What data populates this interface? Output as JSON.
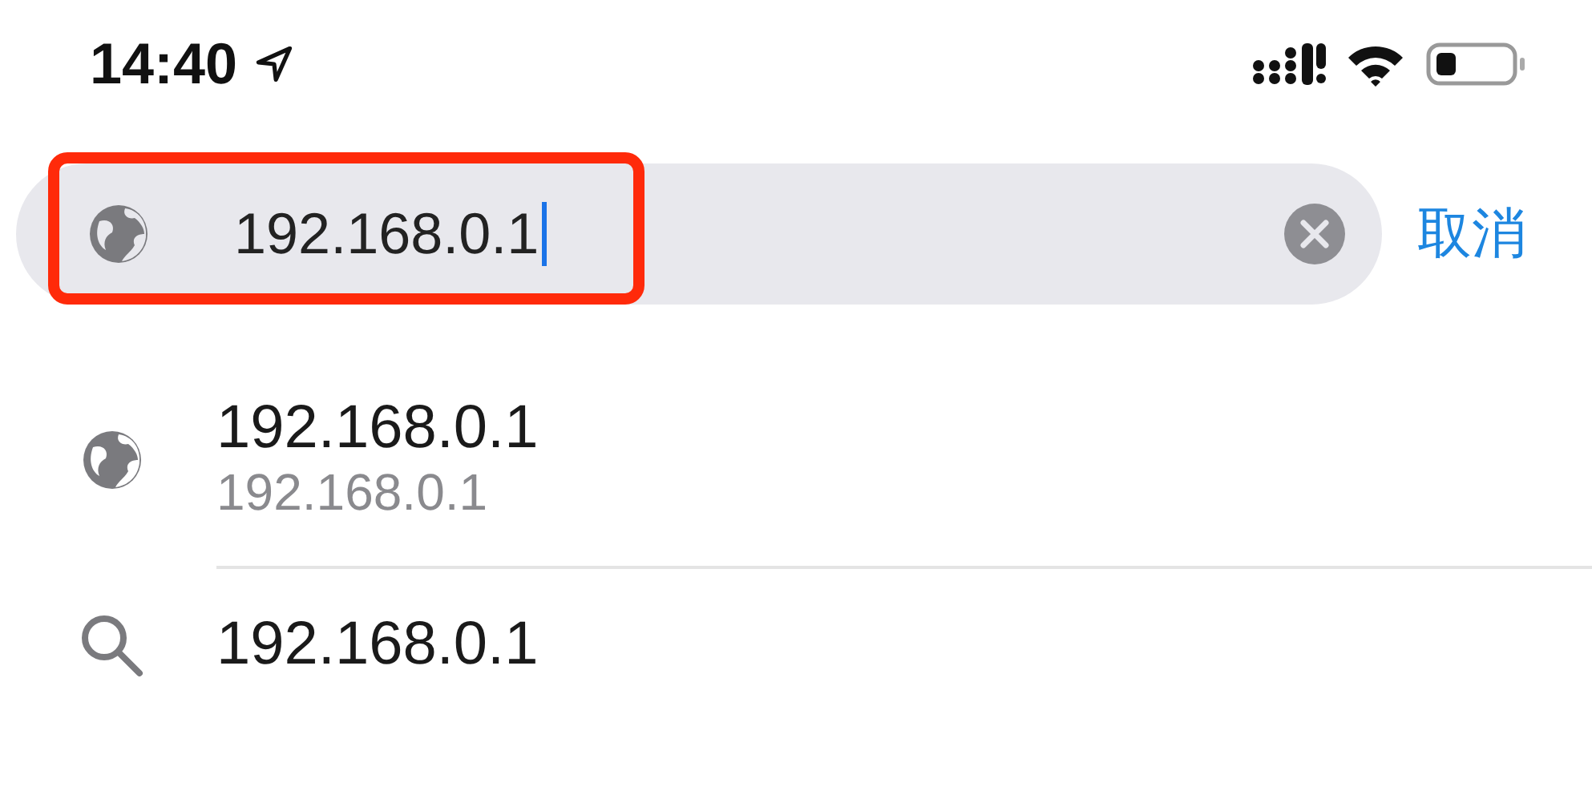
{
  "status_bar": {
    "time": "14:40"
  },
  "search": {
    "value": "192.168.0.1",
    "highlighted": true,
    "cancel": "取消"
  },
  "suggestions": [
    {
      "kind": "url",
      "title": "192.168.0.1",
      "subtitle": "192.168.0.1"
    },
    {
      "kind": "search",
      "title": "192.168.0.1"
    }
  ]
}
